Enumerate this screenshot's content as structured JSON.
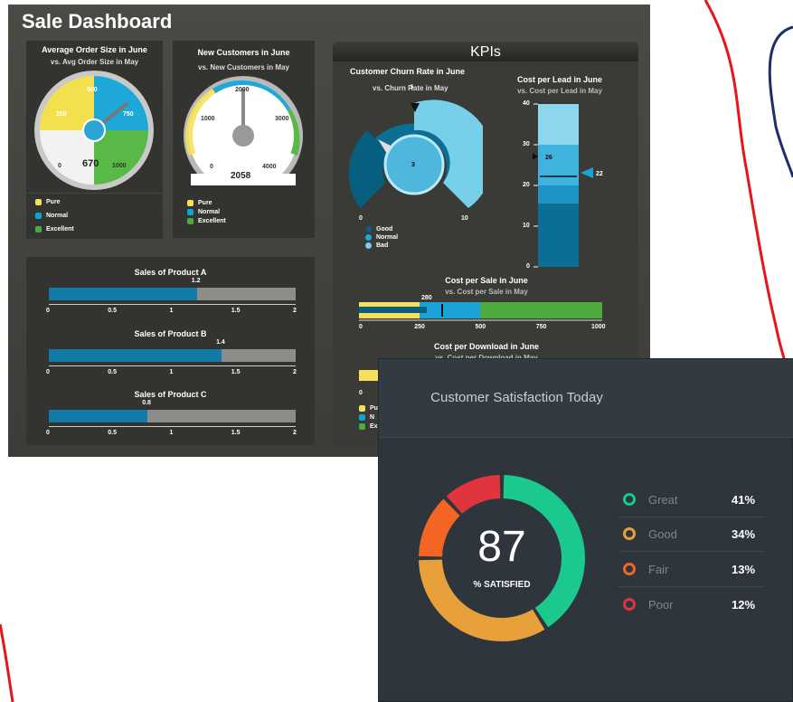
{
  "dashboard": {
    "title": "Sale Dashboard",
    "kpis_title": "KPIs",
    "avg_order": {
      "title": "Average Order Size in June",
      "subtitle": "vs. Avg Order Size in May",
      "value": "670",
      "ticks": [
        "0",
        "250",
        "500",
        "750",
        "1000"
      ],
      "legend": [
        "Pure",
        "Normal",
        "Excellent"
      ]
    },
    "new_customers": {
      "title": "New Customers in June",
      "subtitle": "vs. New Customers in May",
      "value": "2058",
      "ticks": [
        "0",
        "1000",
        "2000",
        "3000",
        "4000"
      ],
      "legend": [
        "Pure",
        "Normal",
        "Excellent"
      ]
    },
    "sales": [
      {
        "title": "Sales of Product A",
        "value": "1.2",
        "ticks": [
          "0",
          "0.5",
          "1",
          "1.5",
          "2"
        ]
      },
      {
        "title": "Sales of Product B",
        "value": "1.4",
        "ticks": [
          "0",
          "0.5",
          "1",
          "1.5",
          "2"
        ]
      },
      {
        "title": "Sales of Product C",
        "value": "0.8",
        "ticks": [
          "0",
          "0.5",
          "1",
          "1.5",
          "2"
        ]
      }
    ],
    "churn": {
      "title": "Customer Churn Rate in June",
      "subtitle": "vs. Churn Rate in May",
      "value": "3",
      "marker": "5",
      "min": "0",
      "max": "10",
      "legend": [
        "Good",
        "Normal",
        "Bad"
      ]
    },
    "cost_per_lead": {
      "title": "Cost per Lead in June",
      "subtitle": "vs. Cost per Lead in May",
      "ticks": [
        "40",
        "30",
        "20",
        "10",
        "0"
      ],
      "current": "22",
      "previous": "26"
    },
    "cost_per_sale": {
      "title": "Cost per Sale in June",
      "subtitle": "vs. Cost per Sale in May",
      "value": "280",
      "ticks": [
        "0",
        "250",
        "500",
        "750",
        "1000"
      ]
    },
    "cost_per_download": {
      "title": "Cost per Download in June",
      "subtitle": "vs. Cost per Download in May",
      "ticks": [
        "0"
      ],
      "legend_partial": [
        "Pu",
        "N",
        "Ex"
      ]
    }
  },
  "satisfaction": {
    "title": "Customer Satisfaction Today",
    "value": "87",
    "label": "% SATISFIED",
    "items": [
      {
        "label": "Great",
        "pct": "41%",
        "color": "#1bc98e"
      },
      {
        "label": "Good",
        "pct": "34%",
        "color": "#e8a13a"
      },
      {
        "label": "Fair",
        "pct": "13%",
        "color": "#f26522"
      },
      {
        "label": "Poor",
        "pct": "12%",
        "color": "#e0343f"
      }
    ]
  },
  "colors": {
    "pure": "#f7e15a",
    "normal": "#0aa5d6",
    "excellent": "#4caa3f",
    "bar_fill": "#117aa6",
    "bar_track": "#8c8c8a"
  }
}
